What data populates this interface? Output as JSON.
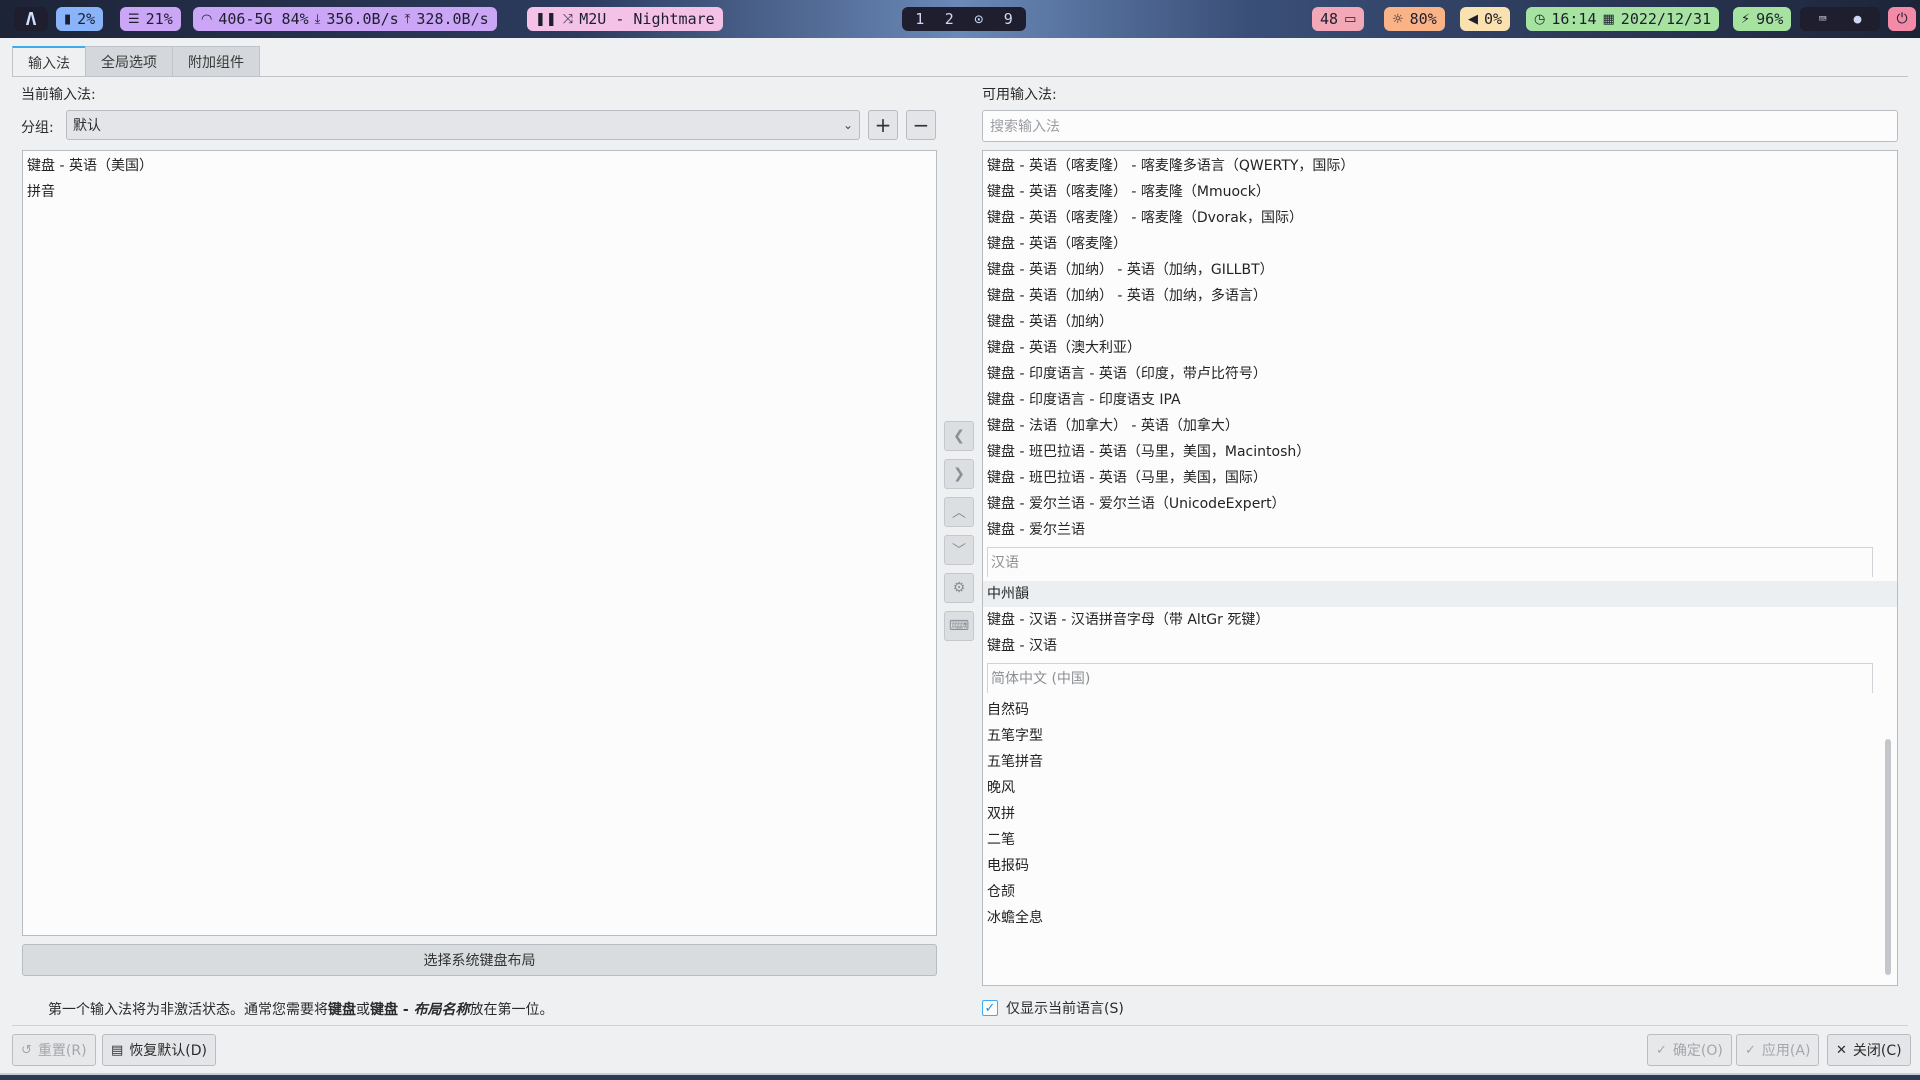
{
  "topbar": {
    "logo": "Λ",
    "cpu": "2%",
    "mem": "21%",
    "network": "406-5G 84%",
    "down": "356.0B/s",
    "up": "328.0B/s",
    "music": "M2U - Nightmare",
    "workspaces": [
      "1",
      "2",
      "⊙",
      "9"
    ],
    "updates": "48",
    "brightness": "80%",
    "volume": "0%",
    "time": "16:14",
    "date": "2022/12/31",
    "battery": "96%"
  },
  "tabs": [
    "输入法",
    "全局选项",
    "附加组件"
  ],
  "left": {
    "current_label": "当前输入法:",
    "group_label": "分组:",
    "group_value": "默认",
    "items": [
      "键盘 - 英语（美国）",
      "拼音"
    ],
    "system_layout_button": "选择系统键盘布局"
  },
  "right": {
    "available_label": "可用输入法:",
    "search_placeholder": "搜索输入法",
    "items_a": [
      "键盘 - 英语（喀麦隆） - 喀麦隆多语言（QWERTY，国际）",
      "键盘 - 英语（喀麦隆） - 喀麦隆（Mmuock）",
      "键盘 - 英语（喀麦隆） - 喀麦隆（Dvorak，国际）",
      "键盘 - 英语（喀麦隆）",
      "键盘 - 英语（加纳） - 英语（加纳，GILLBT）",
      "键盘 - 英语（加纳） - 英语（加纳，多语言）",
      "键盘 - 英语（加纳）",
      "键盘 - 英语（澳大利亚）",
      "键盘 - 印度语言 - 英语（印度，带卢比符号）",
      "键盘 - 印度语言 - 印度语支 IPA",
      "键盘 - 法语（加拿大） - 英语（加拿大）",
      "键盘 - 班巴拉语 - 英语（马里，美国，Macintosh）",
      "键盘 - 班巴拉语 - 英语（马里，美国，国际）",
      "键盘 - 爱尔兰语 - 爱尔兰语（UnicodeExpert）",
      "键盘 - 爱尔兰语"
    ],
    "group_chinese": "汉语",
    "items_b": [
      "中州韻",
      "键盘 - 汉语 - 汉语拼音字母（带 AltGr 死键）",
      "键盘 - 汉语"
    ],
    "group_simplified": "简体中文 (中国)",
    "items_c": [
      "自然码",
      "五笔字型",
      "五笔拼音",
      "晚风",
      "双拼",
      "二笔",
      "电报码",
      "仓颉",
      "冰蟾全息"
    ],
    "only_current_language": "仅显示当前语言(S)"
  },
  "hint": {
    "prefix": "第一个输入法将为非激活状态。通常您需要将",
    "kb1": "键盘",
    "or": "或",
    "kb2": "键盘 - ",
    "layout_name": "布局名称",
    "suffix": "放在第一位。"
  },
  "buttons": {
    "reset": "重置(R)",
    "restore_defaults": "恢复默认(D)",
    "ok": "确定(O)",
    "apply": "应用(A)",
    "close": "关闭(C)"
  }
}
